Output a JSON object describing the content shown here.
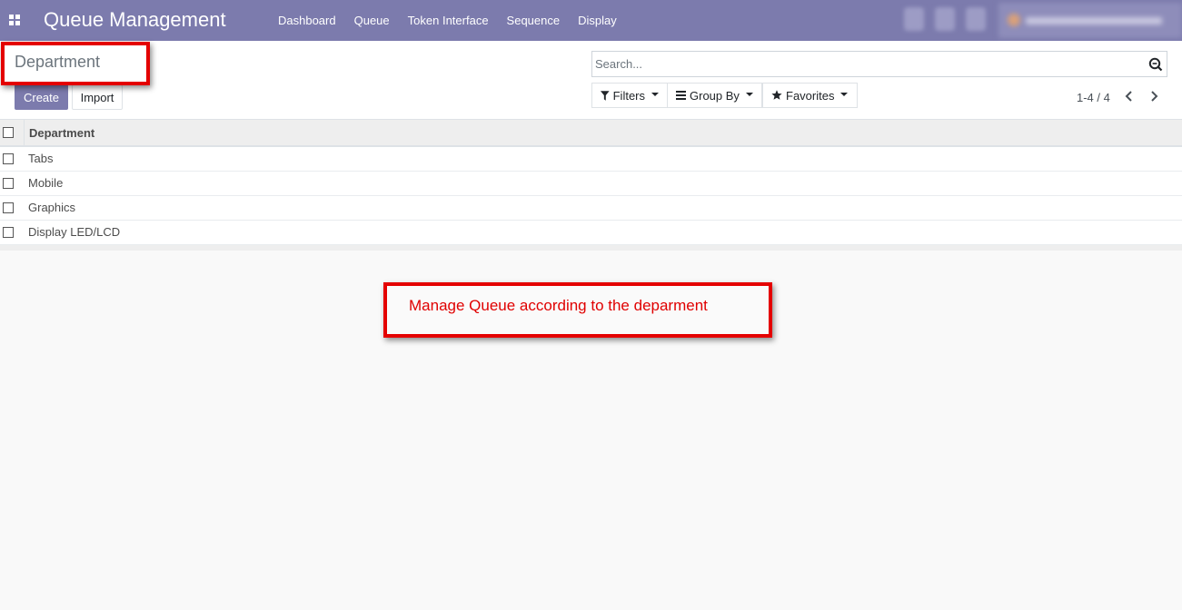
{
  "navbar": {
    "app_title": "Queue Management",
    "apps_icon": "apps-grid-icon",
    "menu": [
      "Dashboard",
      "Queue",
      "Token Interface",
      "Sequence",
      "Display"
    ],
    "brand_color": "#7c7bad"
  },
  "control_panel": {
    "breadcrumb": "Department",
    "create_label": "Create",
    "import_label": "Import",
    "search_placeholder": "Search...",
    "filters_label": "Filters",
    "group_by_label": "Group By",
    "favorites_label": "Favorites",
    "pager": "1-4 / 4"
  },
  "list": {
    "column_header": "Department",
    "rows": [
      "Tabs",
      "Mobile",
      "Graphics",
      "Display LED/LCD"
    ]
  },
  "annotation": {
    "note": "Manage Queue according to the deparment",
    "highlight_color": "#e40000"
  }
}
